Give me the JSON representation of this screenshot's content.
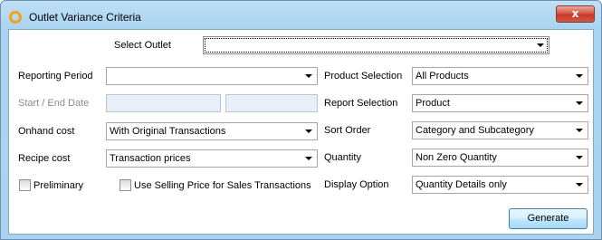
{
  "window": {
    "title": "Outlet Variance Criteria",
    "close_label": "x"
  },
  "form": {
    "select_outlet": {
      "label": "Select Outlet",
      "value": ""
    },
    "reporting_period": {
      "label": "Reporting Period",
      "value": ""
    },
    "start_end_date": {
      "label": "Start / End Date",
      "start_value": "",
      "end_value": ""
    },
    "onhand_cost": {
      "label": "Onhand cost",
      "value": "With Original Transactions"
    },
    "recipe_cost": {
      "label": "Recipe cost",
      "value": "Transaction prices"
    },
    "preliminary": {
      "label": "Preliminary",
      "checked": false
    },
    "use_selling_price": {
      "label": "Use Selling Price for Sales Transactions",
      "checked": false
    },
    "product_selection": {
      "label": "Product Selection",
      "value": "All Products"
    },
    "report_selection": {
      "label": "Report Selection",
      "value": "Product"
    },
    "sort_order": {
      "label": "Sort Order",
      "value": "Category and Subcategory"
    },
    "quantity": {
      "label": "Quantity",
      "value": "Non Zero Quantity"
    },
    "display_option": {
      "label": "Display Option",
      "value": "Quantity Details only"
    }
  },
  "actions": {
    "generate_label": "Generate"
  },
  "colors": {
    "title_icon": "#f2a21b",
    "close_button": "#c7382a",
    "frame": "#aad4f1"
  }
}
